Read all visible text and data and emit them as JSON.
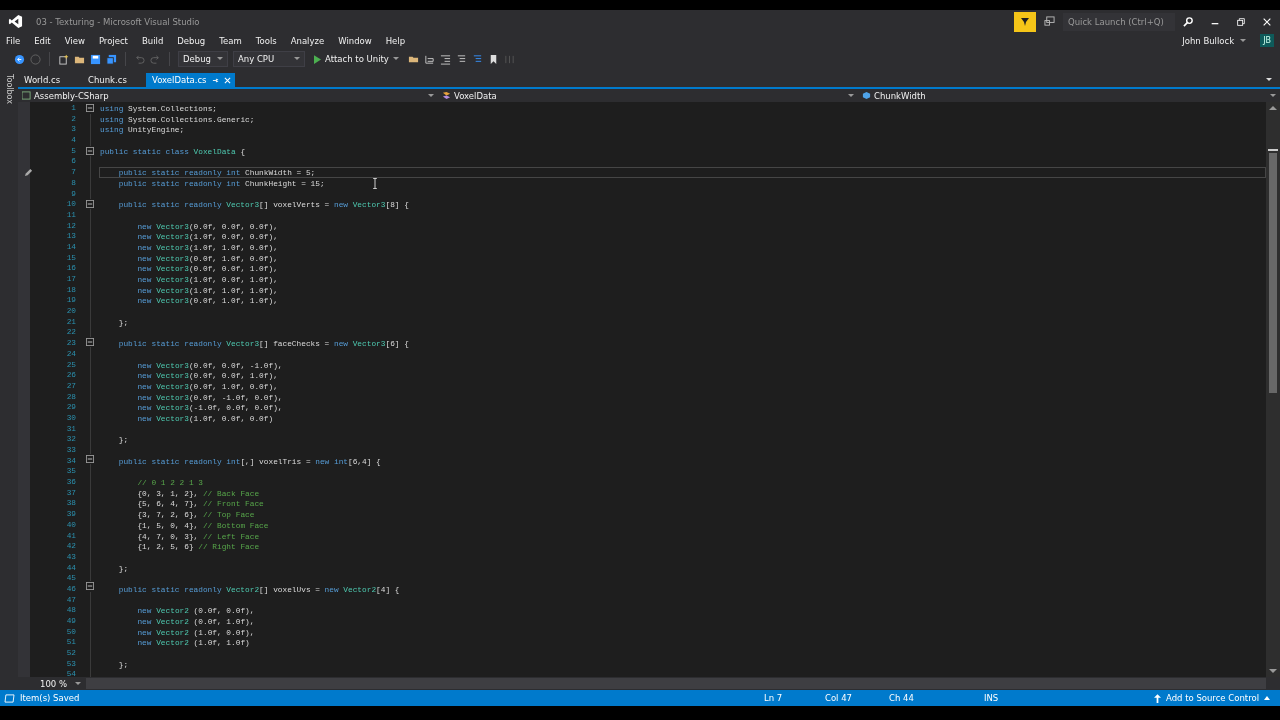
{
  "window": {
    "title": "03 - Texturing - Microsoft Visual Studio"
  },
  "quick_launch": {
    "placeholder": "Quick Launch (Ctrl+Q)"
  },
  "account": {
    "name": "John Bullock",
    "initials": "JB"
  },
  "menu": [
    "File",
    "Edit",
    "View",
    "Project",
    "Build",
    "Debug",
    "Team",
    "Tools",
    "Analyze",
    "Window",
    "Help"
  ],
  "toolbar": {
    "configuration": "Debug",
    "platform": "Any CPU",
    "run_target": "Attach to Unity"
  },
  "side_panel": "Toolbox",
  "tabs": [
    {
      "label": "World.cs",
      "selected": false
    },
    {
      "label": "Chunk.cs",
      "selected": false
    },
    {
      "label": "VoxelData.cs",
      "selected": true
    }
  ],
  "navigation": {
    "project": "Assembly-CSharp",
    "type": "VoxelData",
    "member": "ChunkWidth"
  },
  "code_lines": [
    {
      "number": "1",
      "fold": true,
      "selected": false,
      "tokens": [
        {
          "kind": "keyword",
          "text": "using"
        },
        {
          "kind": "plain",
          "text": " System.Collections;"
        }
      ]
    },
    {
      "number": "2",
      "fold": false,
      "selected": false,
      "tokens": [
        {
          "kind": "keyword",
          "text": "using"
        },
        {
          "kind": "plain",
          "text": " System.Collections.Generic;"
        }
      ]
    },
    {
      "number": "3",
      "fold": false,
      "selected": false,
      "tokens": [
        {
          "kind": "keyword",
          "text": "using"
        },
        {
          "kind": "plain",
          "text": " UnityEngine;"
        }
      ]
    },
    {
      "number": "4",
      "fold": false,
      "selected": false
    },
    {
      "number": "5",
      "fold": true,
      "selected": false,
      "tokens": [
        {
          "kind": "keyword",
          "text": "public static class"
        },
        {
          "kind": "type",
          "text": " VoxelData"
        },
        {
          "kind": "plain",
          "text": " {"
        }
      ]
    },
    {
      "number": "6",
      "fold": false,
      "selected": false
    },
    {
      "number": "7",
      "fold": false,
      "selected": true,
      "tokens": [
        {
          "kind": "keyword",
          "text": "    public static readonly int"
        },
        {
          "kind": "plain",
          "text": " ChunkWidth = 5;"
        }
      ]
    },
    {
      "number": "8",
      "fold": false,
      "selected": false,
      "tokens": [
        {
          "kind": "keyword",
          "text": "    public static readonly int"
        },
        {
          "kind": "plain",
          "text": " ChunkHeight = 15;"
        }
      ]
    },
    {
      "number": "9",
      "fold": false,
      "selected": false
    },
    {
      "number": "10",
      "fold": true,
      "selected": false,
      "tokens": [
        {
          "kind": "keyword",
          "text": "    public static readonly"
        },
        {
          "kind": "type",
          "text": " Vector3"
        },
        {
          "kind": "plain",
          "text": "[] voxelVerts = "
        },
        {
          "kind": "keyword",
          "text": "new"
        },
        {
          "kind": "type",
          "text": " Vector3"
        },
        {
          "kind": "plain",
          "text": "[8] {"
        }
      ]
    },
    {
      "number": "11",
      "fold": false,
      "selected": false
    },
    {
      "number": "12",
      "fold": false,
      "selected": false,
      "tokens": [
        {
          "kind": "keyword",
          "text": "        new"
        },
        {
          "kind": "type",
          "text": " Vector3"
        },
        {
          "kind": "plain",
          "text": "(0.0f, 0.0f, 0.0f),"
        }
      ]
    },
    {
      "number": "13",
      "fold": false,
      "selected": false,
      "tokens": [
        {
          "kind": "keyword",
          "text": "        new"
        },
        {
          "kind": "type",
          "text": " Vector3"
        },
        {
          "kind": "plain",
          "text": "(1.0f, 0.0f, 0.0f),"
        }
      ]
    },
    {
      "number": "14",
      "fold": false,
      "selected": false,
      "tokens": [
        {
          "kind": "keyword",
          "text": "        new"
        },
        {
          "kind": "type",
          "text": " Vector3"
        },
        {
          "kind": "plain",
          "text": "(1.0f, 1.0f, 0.0f),"
        }
      ]
    },
    {
      "number": "15",
      "fold": false,
      "selected": false,
      "tokens": [
        {
          "kind": "keyword",
          "text": "        new"
        },
        {
          "kind": "type",
          "text": " Vector3"
        },
        {
          "kind": "plain",
          "text": "(0.0f, 1.0f, 0.0f),"
        }
      ]
    },
    {
      "number": "16",
      "fold": false,
      "selected": false,
      "tokens": [
        {
          "kind": "keyword",
          "text": "        new"
        },
        {
          "kind": "type",
          "text": " Vector3"
        },
        {
          "kind": "plain",
          "text": "(0.0f, 0.0f, 1.0f),"
        }
      ]
    },
    {
      "number": "17",
      "fold": false,
      "selected": false,
      "tokens": [
        {
          "kind": "keyword",
          "text": "        new"
        },
        {
          "kind": "type",
          "text": " Vector3"
        },
        {
          "kind": "plain",
          "text": "(1.0f, 0.0f, 1.0f),"
        }
      ]
    },
    {
      "number": "18",
      "fold": false,
      "selected": false,
      "tokens": [
        {
          "kind": "keyword",
          "text": "        new"
        },
        {
          "kind": "type",
          "text": " Vector3"
        },
        {
          "kind": "plain",
          "text": "(1.0f, 1.0f, 1.0f),"
        }
      ]
    },
    {
      "number": "19",
      "fold": false,
      "selected": false,
      "tokens": [
        {
          "kind": "keyword",
          "text": "        new"
        },
        {
          "kind": "type",
          "text": " Vector3"
        },
        {
          "kind": "plain",
          "text": "(0.0f, 1.0f, 1.0f),"
        }
      ]
    },
    {
      "number": "20",
      "fold": false,
      "selected": false
    },
    {
      "number": "21",
      "fold": false,
      "selected": false,
      "tokens": [
        {
          "kind": "plain",
          "text": "    };"
        }
      ]
    },
    {
      "number": "22",
      "fold": false,
      "selected": false
    },
    {
      "number": "23",
      "fold": true,
      "selected": false,
      "tokens": [
        {
          "kind": "keyword",
          "text": "    public static readonly"
        },
        {
          "kind": "type",
          "text": " Vector3"
        },
        {
          "kind": "plain",
          "text": "[] faceChecks = "
        },
        {
          "kind": "keyword",
          "text": "new"
        },
        {
          "kind": "type",
          "text": " Vector3"
        },
        {
          "kind": "plain",
          "text": "[6] {"
        }
      ]
    },
    {
      "number": "24",
      "fold": false,
      "selected": false
    },
    {
      "number": "25",
      "fold": false,
      "selected": false,
      "tokens": [
        {
          "kind": "keyword",
          "text": "        new"
        },
        {
          "kind": "type",
          "text": " Vector3"
        },
        {
          "kind": "plain",
          "text": "(0.0f, 0.0f, -1.0f),"
        }
      ]
    },
    {
      "number": "26",
      "fold": false,
      "selected": false,
      "tokens": [
        {
          "kind": "keyword",
          "text": "        new"
        },
        {
          "kind": "type",
          "text": " Vector3"
        },
        {
          "kind": "plain",
          "text": "(0.0f, 0.0f, 1.0f),"
        }
      ]
    },
    {
      "number": "27",
      "fold": false,
      "selected": false,
      "tokens": [
        {
          "kind": "keyword",
          "text": "        new"
        },
        {
          "kind": "type",
          "text": " Vector3"
        },
        {
          "kind": "plain",
          "text": "(0.0f, 1.0f, 0.0f),"
        }
      ]
    },
    {
      "number": "28",
      "fold": false,
      "selected": false,
      "tokens": [
        {
          "kind": "keyword",
          "text": "        new"
        },
        {
          "kind": "type",
          "text": " Vector3"
        },
        {
          "kind": "plain",
          "text": "(0.0f, -1.0f, 0.0f),"
        }
      ]
    },
    {
      "number": "29",
      "fold": false,
      "selected": false,
      "tokens": [
        {
          "kind": "keyword",
          "text": "        new"
        },
        {
          "kind": "type",
          "text": " Vector3"
        },
        {
          "kind": "plain",
          "text": "(-1.0f, 0.0f, 0.0f),"
        }
      ]
    },
    {
      "number": "30",
      "fold": false,
      "selected": false,
      "tokens": [
        {
          "kind": "keyword",
          "text": "        new"
        },
        {
          "kind": "type",
          "text": " Vector3"
        },
        {
          "kind": "plain",
          "text": "(1.0f, 0.0f, 0.0f)"
        }
      ]
    },
    {
      "number": "31",
      "fold": false,
      "selected": false
    },
    {
      "number": "32",
      "fold": false,
      "selected": false,
      "tokens": [
        {
          "kind": "plain",
          "text": "    };"
        }
      ]
    },
    {
      "number": "33",
      "fold": false,
      "selected": false
    },
    {
      "number": "34",
      "fold": true,
      "selected": false,
      "tokens": [
        {
          "kind": "keyword",
          "text": "    public static readonly int"
        },
        {
          "kind": "plain",
          "text": "[,] voxelTris = "
        },
        {
          "kind": "keyword",
          "text": "new int"
        },
        {
          "kind": "plain",
          "text": "[6,4] {"
        }
      ]
    },
    {
      "number": "35",
      "fold": false,
      "selected": false
    },
    {
      "number": "36",
      "fold": false,
      "selected": false,
      "tokens": [
        {
          "kind": "comment",
          "text": "        // 0 1 2 2 1 3"
        }
      ]
    },
    {
      "number": "37",
      "fold": false,
      "selected": false,
      "tokens": [
        {
          "kind": "plain",
          "text": "        {0, 3, 1, 2},"
        },
        {
          "kind": "comment",
          "text": " // Back Face"
        }
      ]
    },
    {
      "number": "38",
      "fold": false,
      "selected": false,
      "tokens": [
        {
          "kind": "plain",
          "text": "        {5, 6, 4, 7},"
        },
        {
          "kind": "comment",
          "text": " // Front Face"
        }
      ]
    },
    {
      "number": "39",
      "fold": false,
      "selected": false,
      "tokens": [
        {
          "kind": "plain",
          "text": "        {3, 7, 2, 6},"
        },
        {
          "kind": "comment",
          "text": " // Top Face"
        }
      ]
    },
    {
      "number": "40",
      "fold": false,
      "selected": false,
      "tokens": [
        {
          "kind": "plain",
          "text": "        {1, 5, 0, 4},"
        },
        {
          "kind": "comment",
          "text": " // Bottom Face"
        }
      ]
    },
    {
      "number": "41",
      "fold": false,
      "selected": false,
      "tokens": [
        {
          "kind": "plain",
          "text": "        {4, 7, 0, 3},"
        },
        {
          "kind": "comment",
          "text": " // Left Face"
        }
      ]
    },
    {
      "number": "42",
      "fold": false,
      "selected": false,
      "tokens": [
        {
          "kind": "plain",
          "text": "        {1, 2, 5, 6}"
        },
        {
          "kind": "comment",
          "text": " // Right Face"
        }
      ]
    },
    {
      "number": "43",
      "fold": false,
      "selected": false
    },
    {
      "number": "44",
      "fold": false,
      "selected": false,
      "tokens": [
        {
          "kind": "plain",
          "text": "    };"
        }
      ]
    },
    {
      "number": "45",
      "fold": false,
      "selected": false
    },
    {
      "number": "46",
      "fold": true,
      "selected": false,
      "tokens": [
        {
          "kind": "keyword",
          "text": "    public static readonly"
        },
        {
          "kind": "type",
          "text": " Vector2"
        },
        {
          "kind": "plain",
          "text": "[] voxelUvs = "
        },
        {
          "kind": "keyword",
          "text": "new"
        },
        {
          "kind": "type",
          "text": " Vector2"
        },
        {
          "kind": "plain",
          "text": "[4] {"
        }
      ]
    },
    {
      "number": "47",
      "fold": false,
      "selected": false
    },
    {
      "number": "48",
      "fold": false,
      "selected": false,
      "tokens": [
        {
          "kind": "keyword",
          "text": "        new"
        },
        {
          "kind": "type",
          "text": " Vector2"
        },
        {
          "kind": "plain",
          "text": " (0.0f, 0.0f),"
        }
      ]
    },
    {
      "number": "49",
      "fold": false,
      "selected": false,
      "tokens": [
        {
          "kind": "keyword",
          "text": "        new"
        },
        {
          "kind": "type",
          "text": " Vector2"
        },
        {
          "kind": "plain",
          "text": " (0.0f, 1.0f),"
        }
      ]
    },
    {
      "number": "50",
      "fold": false,
      "selected": false,
      "tokens": [
        {
          "kind": "keyword",
          "text": "        new"
        },
        {
          "kind": "type",
          "text": " Vector2"
        },
        {
          "kind": "plain",
          "text": " (1.0f, 0.0f),"
        }
      ]
    },
    {
      "number": "51",
      "fold": false,
      "selected": false,
      "tokens": [
        {
          "kind": "keyword",
          "text": "        new"
        },
        {
          "kind": "type",
          "text": " Vector2"
        },
        {
          "kind": "plain",
          "text": " (1.0f, 1.0f)"
        }
      ]
    },
    {
      "number": "52",
      "fold": false,
      "selected": false
    },
    {
      "number": "53",
      "fold": false,
      "selected": false,
      "tokens": [
        {
          "kind": "plain",
          "text": "    };"
        }
      ]
    },
    {
      "number": "54",
      "fold": false,
      "selected": false
    }
  ],
  "zoom": "100 %",
  "status_bar": {
    "message": "Item(s) Saved",
    "line": "Ln 7",
    "column": "Col 47",
    "character": "Ch 44",
    "mode": "INS",
    "source_control": "Add to Source Control"
  }
}
